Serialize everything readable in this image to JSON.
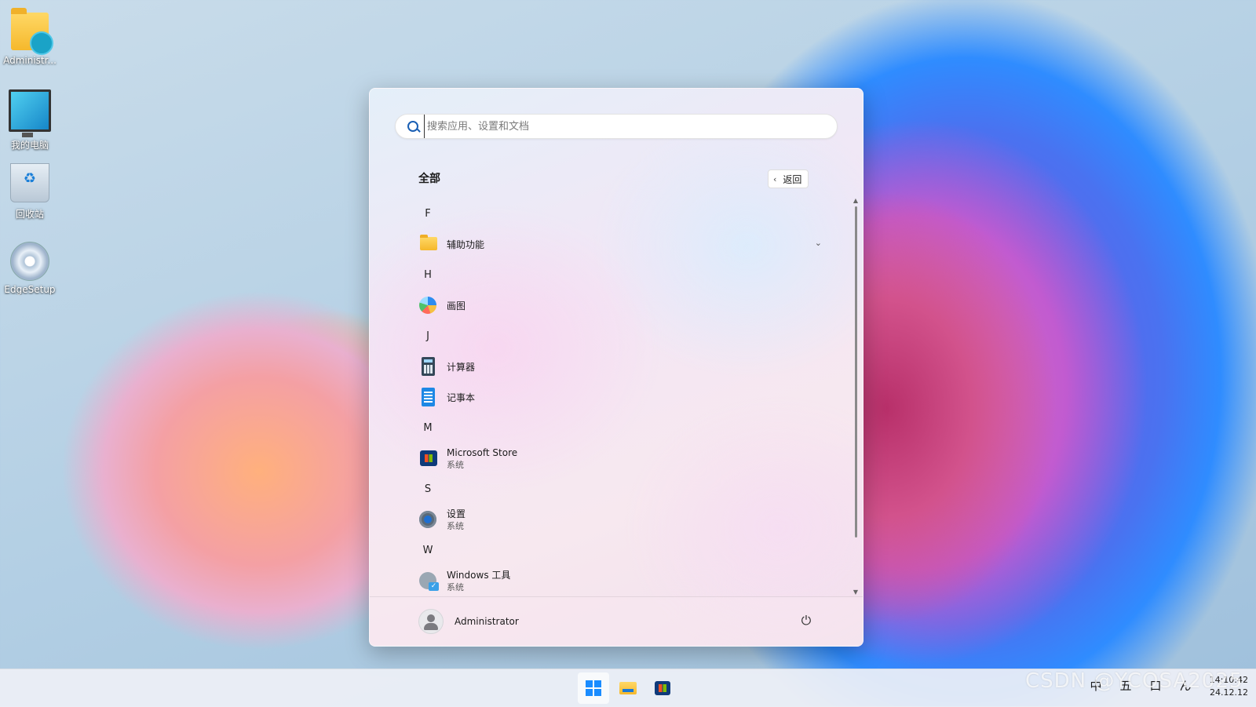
{
  "desktop": {
    "icons": [
      {
        "label": "Administr...",
        "icon": "user-folder-icon"
      },
      {
        "label": "我的电脑",
        "icon": "computer-icon"
      },
      {
        "label": "回收站",
        "icon": "recycle-bin-icon"
      },
      {
        "label": "EdgeSetup",
        "icon": "setup-disc-icon"
      }
    ]
  },
  "start_menu": {
    "search_placeholder": "搜索应用、设置和文档",
    "section_title": "全部",
    "back_label": "返回",
    "groups": [
      {
        "letter": "F",
        "apps": [
          {
            "name": "辅助功能",
            "sub": "",
            "icon": "folder-icon",
            "expandable": true
          }
        ]
      },
      {
        "letter": "H",
        "apps": [
          {
            "name": "画图",
            "sub": "",
            "icon": "paint-icon"
          }
        ]
      },
      {
        "letter": "J",
        "apps": [
          {
            "name": "计算器",
            "sub": "",
            "icon": "calculator-icon"
          },
          {
            "name": "记事本",
            "sub": "",
            "icon": "notepad-icon"
          }
        ]
      },
      {
        "letter": "M",
        "apps": [
          {
            "name": "Microsoft Store",
            "sub": "系统",
            "icon": "store-icon"
          }
        ]
      },
      {
        "letter": "S",
        "apps": [
          {
            "name": "设置",
            "sub": "系统",
            "icon": "settings-gear-icon"
          }
        ]
      },
      {
        "letter": "W",
        "apps": [
          {
            "name": "Windows 工具",
            "sub": "系统",
            "icon": "windows-tools-icon"
          }
        ]
      }
    ],
    "user_name": "Administrator"
  },
  "taskbar": {
    "tray": [
      "中",
      "五",
      "口",
      "ん"
    ],
    "time": "14:10:42",
    "date": "24.12.12"
  },
  "watermark": "CSDN @YCOSA2025",
  "colors": {
    "accent": "#1a8cff"
  }
}
